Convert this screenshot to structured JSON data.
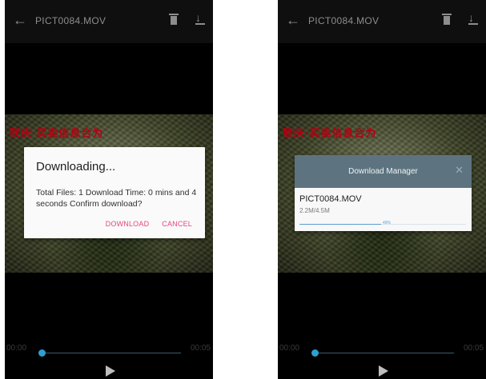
{
  "left_screen": {
    "title": "PICT0084.MOV",
    "overlay_text": "联庆·买卖信息合为",
    "dialog": {
      "title": "Downloading...",
      "message": "Total Files: 1 Download Time: 0 mins and 4 seconds Confirm download?",
      "download_label": "DOWNLOAD",
      "cancel_label": "CANCEL"
    },
    "player": {
      "current_time": "00:00",
      "total_time": "00:05",
      "progress": 0.02
    }
  },
  "right_screen": {
    "title": "PICT0084.MOV",
    "overlay_text": "联庆·买卖信息合为",
    "download_manager": {
      "title": "Download Manager",
      "close_symbol": "✕",
      "file_name": "PICT0084.MOV",
      "file_size": "2.2M/4.5M",
      "progress_label": "49%",
      "progress": 0.49
    },
    "player": {
      "current_time": "00:00",
      "total_time": "00:05",
      "progress": 0.02
    }
  },
  "colors": {
    "accent_pink": "#e6457f",
    "knob_blue": "#2f9fd0",
    "manager_header": "#5d7480",
    "overlay_red": "#b3000f"
  },
  "icons": [
    "back-arrow-icon",
    "trash-icon",
    "download-icon",
    "play-icon",
    "close-icon"
  ]
}
